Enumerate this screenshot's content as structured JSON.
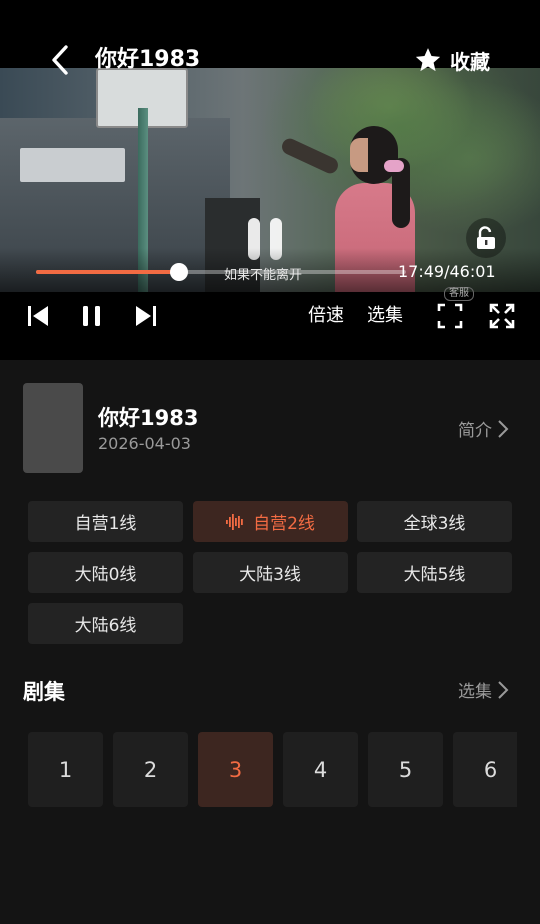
{
  "header": {
    "title": "你好1983",
    "favorite_label": "收藏"
  },
  "player": {
    "subtitle": "如果不能离开",
    "time_display": "17:49/46:01",
    "progress_fraction": 0.3874,
    "watermark": "客服",
    "speed_label": "倍速",
    "episodes_label": "选集",
    "accent_color": "#f26b43"
  },
  "show": {
    "title": "你好1983",
    "date": "2026-04-03",
    "intro_label": "简介"
  },
  "lines": [
    {
      "label": "自营1线",
      "active": false
    },
    {
      "label": "自营2线",
      "active": true
    },
    {
      "label": "全球3线",
      "active": false
    },
    {
      "label": "大陆0线",
      "active": false
    },
    {
      "label": "大陆3线",
      "active": false
    },
    {
      "label": "大陆5线",
      "active": false
    },
    {
      "label": "大陆6线",
      "active": false
    }
  ],
  "episodes_section": {
    "title": "剧集",
    "select_label": "选集",
    "items": [
      "1",
      "2",
      "3",
      "4",
      "5",
      "6"
    ],
    "active": "3"
  }
}
